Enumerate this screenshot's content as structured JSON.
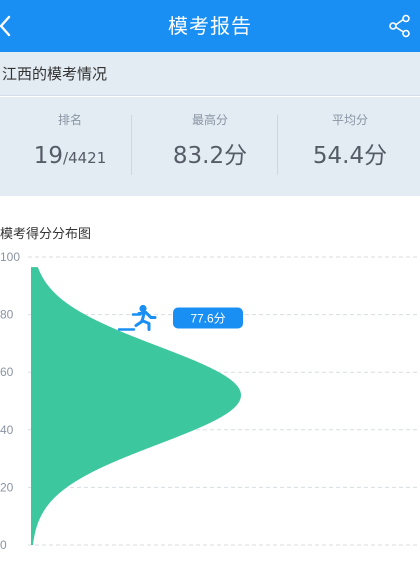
{
  "header": {
    "title": "模考报告",
    "back_icon": "chevron-left-icon",
    "share_icon": "share-icon",
    "background": "#1a8ff3"
  },
  "region": {
    "label": "江西的模考情况"
  },
  "stats": [
    {
      "label": "排名",
      "value": "19",
      "sub": "/4421"
    },
    {
      "label": "最高分",
      "value": "83.2分",
      "sub": ""
    },
    {
      "label": "平均分",
      "value": "54.4分",
      "sub": ""
    }
  ],
  "chart_data": {
    "type": "area",
    "title": "模考得分分布图",
    "ylim": [
      0,
      100
    ],
    "yticks": [
      "100",
      "80",
      "60",
      "40",
      "20",
      "0"
    ],
    "tick_values": [
      100,
      80,
      60,
      40,
      20,
      0
    ],
    "distribution_peak_score": 52,
    "fill_color": "#3cc79f",
    "marker": {
      "score": 77.6,
      "label": "77.6分",
      "icon": "runner-icon",
      "color": "#1a8ff3"
    }
  }
}
